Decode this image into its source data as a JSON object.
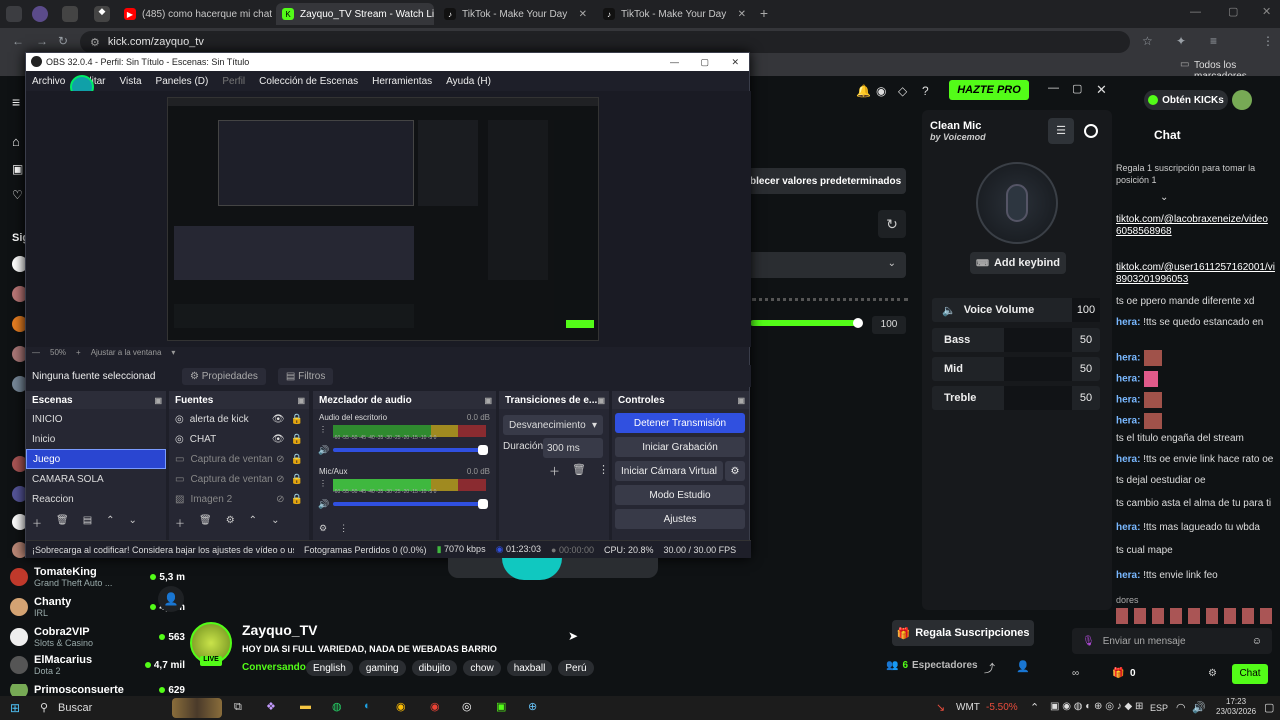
{
  "browser": {
    "tabs": [
      {
        "label": "(485) como hacerque mi chat n",
        "icon": "youtube-icon",
        "color": "#ff0000"
      },
      {
        "label": "Zayquo_TV Stream - Watch Live",
        "icon": "kick-icon",
        "color": "#53fc18"
      },
      {
        "label": "TikTok - Make Your Day",
        "icon": "tiktok-icon",
        "color": "#111111"
      },
      {
        "label": "TikTok - Make Your Day",
        "icon": "tiktok-icon",
        "color": "#111111"
      }
    ],
    "url": "kick.com/zayquo_tv",
    "bookmarks_label": "Todos los marcadores"
  },
  "obs": {
    "title": "OBS 32.0.4 - Perfil: Sin Título - Escenas: Sin Título",
    "menu": [
      "Archivo",
      "Editar",
      "Vista",
      "Paneles (D)",
      "Perfil",
      "Colección de Escenas",
      "Herramientas",
      "Ayuda (H)"
    ],
    "zoom": "50%",
    "fit": "Ajustar a la ventana",
    "no_source": "Ninguna fuente seleccionad",
    "properties": "Propiedades",
    "filters": "Filtros",
    "scenes_title": "Escenas",
    "scenes": [
      "INICIO",
      "Inicio",
      "Juego",
      "CAMARA SOLA",
      "Reaccion"
    ],
    "selected_scene": "Juego",
    "sources_title": "Fuentes",
    "sources": [
      "alerta de kick",
      "CHAT",
      "Captura de ventan",
      "Captura de ventan",
      "Imagen 2"
    ],
    "mixer_title": "Mezclador de audio",
    "mixer": [
      {
        "name": "Audio del escritorio",
        "db": "0.0 dB"
      },
      {
        "name": "Mic/Aux",
        "db": "0.0 dB"
      }
    ],
    "meter_ticks": "-60 -55 -50 -45 -40 -35 -30 -25 -20 -15 -10 -5 0",
    "transitions_title": "Transiciones de e...",
    "transition": "Desvanecimiento",
    "duration_label": "Duración",
    "duration": "300 ms",
    "controls_title": "Controles",
    "controls": [
      "Detener Transmisión",
      "Iniciar Grabación",
      "Iniciar Cámara Virtual",
      "Modo Estudio",
      "Ajustes"
    ],
    "status": {
      "warning": "¡Sobrecarga al codificar! Considera bajar los ajustes de vídeo o usa",
      "dropped": "Fotogramas Perdidos 0 (0.0%)",
      "bitrate": "7070 kbps",
      "stream_time": "01:23:03",
      "rec_time": "00:00:00",
      "cpu": "CPU: 20.8%",
      "fps": "30.00 / 30.00 FPS"
    }
  },
  "kick": {
    "hazte_pro": "HAZTE PRO",
    "obten": "Obtén KICKs",
    "restore_defaults": "blecer valores predeterminados",
    "volume_value": "100",
    "channels": [
      {
        "name": "TomateKing",
        "game": "Grand Theft Auto ...",
        "viewers": "5,3 m"
      },
      {
        "name": "Chanty",
        "game": "IRL",
        "viewers": "4,7 m"
      },
      {
        "name": "Cobra2VIP",
        "game": "Slots & Casino",
        "viewers": "563"
      },
      {
        "name": "ElMacarius",
        "game": "Dota 2",
        "viewers": "4,7 mil"
      },
      {
        "name": "Primosconsuerte",
        "game": "",
        "viewers": "629"
      }
    ],
    "left_label": "Sig",
    "streamer": {
      "name": "Zayquo_TV",
      "title": "HOY DIA SI FULL VARIEDAD, NADA DE WEBADAS BARRIO",
      "live": "LIVE",
      "category": "Conversando",
      "tags": [
        "English",
        "gaming",
        "dibujito",
        "chow",
        "haxball",
        "Perú"
      ],
      "subs_button": "Regala Suscripciones",
      "viewers": "6",
      "viewers_label": "Espectadores"
    }
  },
  "voicemod": {
    "title": "Clean Mic",
    "by": "by Voicemod",
    "keybind": "Add keybind",
    "sliders": [
      {
        "label": "Voice Volume",
        "value": "100"
      },
      {
        "label": "Bass",
        "value": "50"
      },
      {
        "label": "Mid",
        "value": "50"
      },
      {
        "label": "Treble",
        "value": "50"
      }
    ]
  },
  "chat": {
    "title": "Chat",
    "pinned": "Regala 1 suscripción para tomar la posición 1",
    "messages": [
      {
        "user": "",
        "text": "tiktok.com/@lacobraxeneize/video 6058568968",
        "link": true
      },
      {
        "user": "",
        "text": "tiktok.com/@user1611257162001/vi 8903201996053",
        "link": true
      },
      {
        "user": "",
        "text": "ts oe ppero mande diferente xd"
      },
      {
        "user": "hera:",
        "text": "!tts se quedo estancado en"
      },
      {
        "user": "hera:",
        "text": ""
      },
      {
        "user": "hera:",
        "text": ""
      },
      {
        "user": "hera:",
        "text": ""
      },
      {
        "user": "hera:",
        "text": ""
      },
      {
        "user": "",
        "text": "ts el titulo engaña del stream"
      },
      {
        "user": "hera:",
        "text": "!tts oe envie link hace rato oe"
      },
      {
        "user": "",
        "text": "ts dejal oestudiar oe"
      },
      {
        "user": "",
        "text": "ts cambio asta el alma de tu para ti"
      },
      {
        "user": "hera:",
        "text": "!tts mas lagueado tu wbda"
      },
      {
        "user": "",
        "text": "ts cual mape"
      },
      {
        "user": "hera:",
        "text": "!tts envie link feo"
      }
    ],
    "donors": "dores",
    "input_placeholder": "Enviar un mensaje",
    "points": "0",
    "send": "Chat"
  },
  "taskbar": {
    "search": "Buscar",
    "stock": "WMT",
    "stock_change": "-5.50%",
    "lang": "ESP",
    "time": "17:23",
    "date": "23/03/2026"
  },
  "colors": {
    "kick_green": "#53fc18",
    "obs_blue": "#3050e0"
  }
}
